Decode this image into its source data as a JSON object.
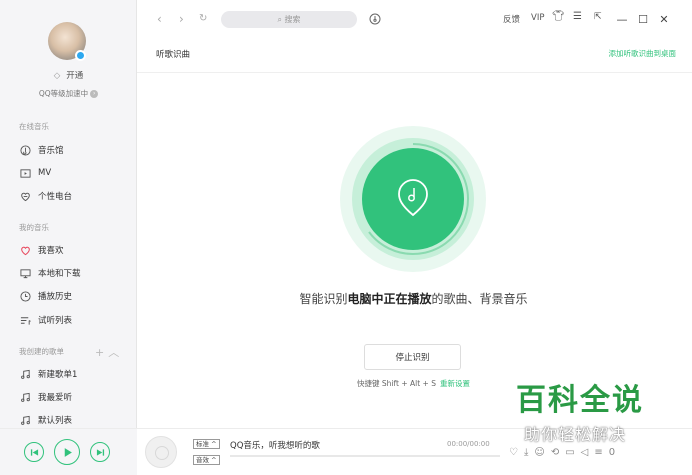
{
  "sidebar": {
    "vip_label": "开通",
    "level_label": "QQ等级加速中",
    "online_music_title": "在线音乐",
    "online_items": [
      {
        "label": "音乐馆",
        "icon": "music-hall-icon"
      },
      {
        "label": "MV",
        "icon": "mv-icon"
      },
      {
        "label": "个性电台",
        "icon": "radio-icon"
      }
    ],
    "my_music_title": "我的音乐",
    "my_items": [
      {
        "label": "我喜欢",
        "icon": "heart-icon"
      },
      {
        "label": "本地和下载",
        "icon": "monitor-icon"
      },
      {
        "label": "播放历史",
        "icon": "clock-icon"
      },
      {
        "label": "试听列表",
        "icon": "list-icon"
      }
    ],
    "created_title": "我创建的歌单",
    "created_items": [
      {
        "label": "新建歌单1",
        "icon": "note-icon"
      },
      {
        "label": "我最爱听",
        "icon": "note-icon"
      },
      {
        "label": "默认列表",
        "icon": "note-icon"
      }
    ]
  },
  "topbar": {
    "search_placeholder": "搜索",
    "feedback": "反馈",
    "vip": "VIP"
  },
  "content": {
    "title": "听歌识曲",
    "add_to_desktop": "添加听歌识曲到桌面",
    "caption_prefix": "智能识别",
    "caption_bold": "电脑中正在播放",
    "caption_suffix": "的歌曲、背景音乐",
    "stop_button": "停止识别",
    "shortcut_text": "快捷键 Shift + Alt + S",
    "reset_link": "重新设置"
  },
  "player": {
    "quality_standard": "标准",
    "quality_effect": "音效",
    "now_playing": "QQ音乐，听我想听的歌",
    "time": "00:00/00:00",
    "playlist_count": "0"
  },
  "watermark": {
    "title": "百科全说",
    "subtitle": "助你轻松解决"
  },
  "colors": {
    "accent": "#31c27c",
    "sidebar_bg": "#f5f5f7"
  }
}
